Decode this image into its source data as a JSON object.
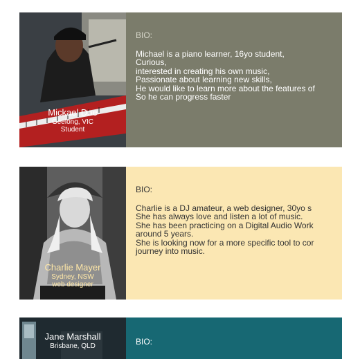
{
  "cards": [
    {
      "name": "Mickael Doe",
      "location": "Geelong, VIC",
      "role": "Student",
      "bio_label": "BIO:",
      "bio_lines": [
        "Michael is a piano learner, 16yo student,",
        "Curious,",
        "interested in creating his own music,",
        "Passionate about learning new skills,",
        "He would like to learn more about the features of",
        "So he can progress faster"
      ],
      "bio_color": "#7b7c6b"
    },
    {
      "name": "Charlie Mayer",
      "location": "Sydney, NSW",
      "role": "web designer",
      "bio_label": "BIO:",
      "bio_lines": [
        "Charlie is a DJ amateur, a web designer, 30yo s",
        "She has always love and listen a lot of music.",
        "She has been practicing on a Digital Audio Work",
        "around 5 years.",
        "She is looking now for a more specific tool to cor",
        "journey into music."
      ],
      "bio_color": "#fbe7b3"
    },
    {
      "name": "Jane Marshall",
      "location": "Brisbane, QLD",
      "bio_label": "BIO:",
      "bio_color": "#176873"
    }
  ]
}
